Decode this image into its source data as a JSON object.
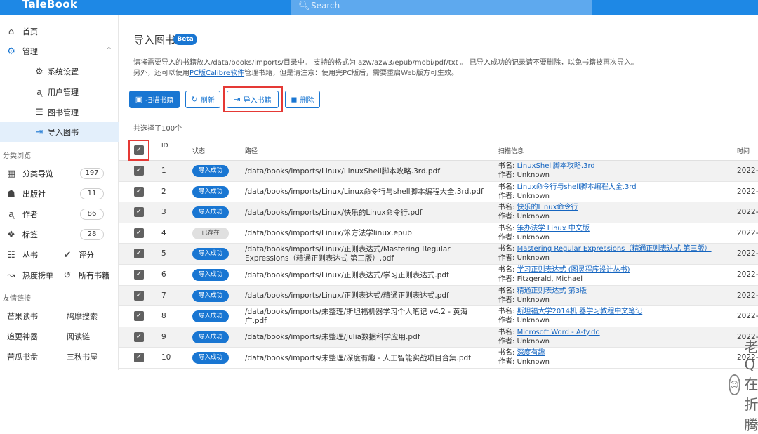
{
  "app": {
    "title": "TaleBook",
    "search_placeholder": "Search"
  },
  "sidebar": {
    "main_items": [
      {
        "label": "首页",
        "icon": "home-icon"
      },
      {
        "label": "管理",
        "icon": "gear-icon"
      },
      {
        "label": "系统设置",
        "icon": "settings-icon"
      },
      {
        "label": "用户管理",
        "icon": "user-icon"
      },
      {
        "label": "图书管理",
        "icon": "library-icon"
      },
      {
        "label": "导入图书",
        "icon": "import-icon"
      }
    ],
    "browse_title": "分类浏览",
    "browse_items": [
      {
        "label": "分类导览",
        "count": "197"
      },
      {
        "label": "出版社",
        "count": "11"
      },
      {
        "label": "作者",
        "count": "86"
      },
      {
        "label": "标签",
        "count": "28"
      }
    ],
    "pair_items": [
      [
        "丛书",
        "评分"
      ],
      [
        "热度榜单",
        "所有书籍"
      ]
    ],
    "links_title": "友情链接",
    "links": [
      [
        "芒果读书",
        "鸠摩搜索"
      ],
      [
        "追更神器",
        "阅读链"
      ],
      [
        "苦瓜书盘",
        "三秋书屋"
      ]
    ]
  },
  "page": {
    "title": "导入图书",
    "beta": "Beta",
    "desc1": "请将需要导入的书籍放入/data/books/imports/目录中。 支持的格式为 azw/azw3/epub/mobi/pdf/txt 。 已导入成功的记录请不要删除，以免书籍被再次导入。",
    "desc2_pre": "另外，还可以使用",
    "desc2_link": "PC版Calibre软件",
    "desc2_post": "管理书籍，但是请注意：使用完PC版后，需要重启Web版方可生效。",
    "buttons": {
      "scan": "扫描书籍",
      "refresh": "刷新",
      "import": "导入书籍",
      "delete": "删除"
    },
    "selected": "共选择了100个"
  },
  "table": {
    "headers": {
      "id": "ID",
      "status": "状态",
      "path": "路径",
      "scan": "扫描信息",
      "time": "时间"
    },
    "scan_title_label": "书名:",
    "scan_author_label": "作者:",
    "rows": [
      {
        "id": "1",
        "status": "导入成功",
        "path": "/data/books/imports/Linux/LinuxShell脚本攻略.3rd.pdf",
        "title": "LinuxShell脚本攻略.3rd",
        "author": "Unknown",
        "time": "2022-"
      },
      {
        "id": "2",
        "status": "导入成功",
        "path": "/data/books/imports/Linux/Linux命令行与shell脚本编程大全.3rd.pdf",
        "title": "Linux命令行与shell脚本编程大全.3rd",
        "author": "Unknown",
        "time": "2022-"
      },
      {
        "id": "3",
        "status": "导入成功",
        "path": "/data/books/imports/Linux/快乐的Linux命令行.pdf",
        "title": "快乐的Linux命令行",
        "author": "Unknown",
        "time": "2022-"
      },
      {
        "id": "4",
        "status": "已存在",
        "path": "/data/books/imports/Linux/笨方法学linux.epub",
        "title": "笨办法学 Linux 中文版",
        "author": "Unknown",
        "time": "2022-"
      },
      {
        "id": "5",
        "status": "导入成功",
        "path": "/data/books/imports/Linux/正则表达式/Mastering Regular Expressions（精通正则表达式 第三版）.pdf",
        "title": "Mastering Regular Expressions（精通正则表达式 第三版）",
        "author": "Unknown",
        "time": "2022-"
      },
      {
        "id": "6",
        "status": "导入成功",
        "path": "/data/books/imports/Linux/正则表达式/学习正则表达式.pdf",
        "title": "学习正则表达式 (图灵程序设计丛书)",
        "author": "Fitzgerald, Michael",
        "time": "2022-"
      },
      {
        "id": "7",
        "status": "导入成功",
        "path": "/data/books/imports/Linux/正则表达式/精通正则表达式.pdf",
        "title": "精通正则表达式 第3版",
        "author": "Unknown",
        "time": "2022-"
      },
      {
        "id": "8",
        "status": "导入成功",
        "path": "/data/books/imports/未整理/斯坦福机器学习个人笔记 v4.2 - 黄海广.pdf",
        "title": "斯坦福大学2014机 器学习教程中文笔记",
        "author": "Unknown",
        "time": "2022-"
      },
      {
        "id": "9",
        "status": "导入成功",
        "path": "/data/books/imports/未整理/Julia数据科学应用.pdf",
        "title": "Microsoft Word - A-fy.do",
        "author": "Unknown",
        "time": "2022-"
      },
      {
        "id": "10",
        "status": "导入成功",
        "path": "/data/books/imports/未整理/深度有趣 - 人工智能实战项目合集.pdf",
        "title": "深度有趣",
        "author": "Unknown",
        "time": "2022-"
      }
    ]
  },
  "watermark": "老Q在折腾",
  "colors": {
    "primary": "#1976d2",
    "topbar": "#1e88e5",
    "highlight": "#e53935"
  }
}
